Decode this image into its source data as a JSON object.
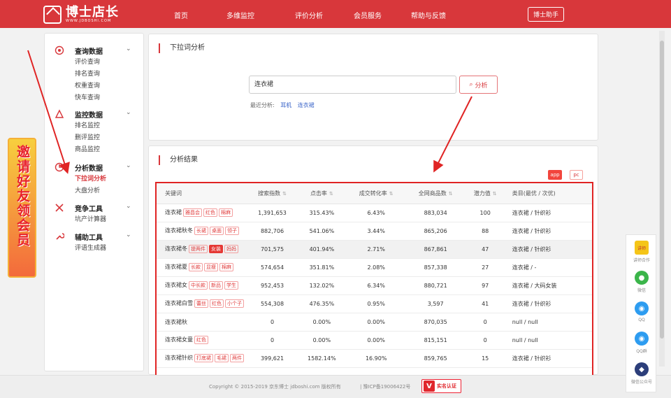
{
  "header": {
    "logo_title": "博士店长",
    "logo_sub": "WWW.JDBOSHI.COM",
    "nav": [
      "首页",
      "多维监控",
      "评价分析",
      "会员服务",
      "帮助与反馈"
    ],
    "helper_button": "博士助手"
  },
  "sidebar": {
    "groups": [
      {
        "title": "查询数据",
        "icon": "query-icon",
        "items": [
          "评价查询",
          "排名查询",
          "权重查询",
          "快车查询"
        ]
      },
      {
        "title": "监控数据",
        "icon": "monitor-icon",
        "items": [
          "排名监控",
          "删评监控",
          "商品监控"
        ]
      },
      {
        "title": "分析数据",
        "icon": "analysis-icon",
        "items": [
          "下拉词分析",
          "大盘分析"
        ]
      },
      {
        "title": "竞争工具",
        "icon": "compete-icon",
        "items": [
          "坑产计算器"
        ]
      },
      {
        "title": "辅助工具",
        "icon": "wrench-icon",
        "items": [
          "评语生成器"
        ]
      }
    ],
    "active_item": "下拉词分析"
  },
  "promo": {
    "text": "邀请好友领会员"
  },
  "search_panel": {
    "title": "下拉词分析",
    "input_value": "连衣裙",
    "button_label": "分析",
    "recent_label": "最近分析:",
    "recent_items": [
      "耳机",
      "连衣裙"
    ]
  },
  "results_panel": {
    "title": "分析结果",
    "toggle": [
      "app",
      "pc"
    ],
    "columns": [
      "关键词",
      "搜索指数",
      "点击率",
      "成交转化率",
      "全网商品数",
      "潜力值",
      "类目(最优 / 次优)"
    ],
    "rows": [
      {
        "keyword": "连衣裙",
        "tags": [
          "雅昌会",
          "红色",
          "棉麻"
        ],
        "search": "1,391,653",
        "ctr": "315.43%",
        "cvr": "6.43%",
        "goods": "883,034",
        "potential": "100",
        "category": "连衣裙 / 针织衫"
      },
      {
        "keyword": "连衣裙秋冬",
        "tags": [
          "长裙",
          "桌面",
          "领子"
        ],
        "search": "882,706",
        "ctr": "541.06%",
        "cvr": "3.44%",
        "goods": "865,206",
        "potential": "88",
        "category": "连衣裙 / 针织衫"
      },
      {
        "keyword": "连衣裙冬",
        "tags": [
          "提两件",
          "女装",
          "妈妈"
        ],
        "search": "701,575",
        "ctr": "401.94%",
        "cvr": "2.71%",
        "goods": "867,861",
        "potential": "47",
        "category": "连衣裙 / 针织衫"
      },
      {
        "keyword": "连衣裙夏",
        "tags": [
          "长款",
          "显瘦",
          "棉麻"
        ],
        "search": "574,654",
        "ctr": "351.81%",
        "cvr": "2.08%",
        "goods": "857,338",
        "potential": "27",
        "category": "连衣裙 / -"
      },
      {
        "keyword": "连衣裙女",
        "tags": [
          "中长款",
          "新品",
          "学生"
        ],
        "search": "952,453",
        "ctr": "132.02%",
        "cvr": "6.34%",
        "goods": "880,721",
        "potential": "97",
        "category": "连衣裙 / 大码女装"
      },
      {
        "keyword": "连衣裙白雪",
        "tags": [
          "蕾丝",
          "红色",
          "小个子"
        ],
        "search": "554,308",
        "ctr": "476.35%",
        "cvr": "0.95%",
        "goods": "3,597",
        "potential": "41",
        "category": "连衣裙 / 针织衫"
      },
      {
        "keyword": "连衣裙秋",
        "tags": [],
        "search": "0",
        "ctr": "0.00%",
        "cvr": "0.00%",
        "goods": "870,035",
        "potential": "0",
        "category": "null / null"
      },
      {
        "keyword": "连衣裙女童",
        "tags": [
          "红色"
        ],
        "search": "0",
        "ctr": "0.00%",
        "cvr": "0.00%",
        "goods": "815,151",
        "potential": "0",
        "category": "null / null"
      },
      {
        "keyword": "连衣裙针织",
        "tags": [
          "打底裙",
          "毛裙",
          "两件"
        ],
        "search": "399,621",
        "ctr": "1582.14%",
        "cvr": "16.90%",
        "goods": "859,765",
        "potential": "15",
        "category": "连衣裙 / 针织衫"
      }
    ]
  },
  "footer": {
    "copyright": "Copyright © 2015-2019 京东博士 jdboshi.com 版权所有",
    "icp": "|   豫ICP备19006422号",
    "badge": "实名认证"
  },
  "tools": [
    {
      "label": "讲师合作",
      "icon": "cooperation-icon",
      "color": "#f5c518"
    },
    {
      "label": "微信",
      "icon": "wechat-icon",
      "color": "#3bb54a"
    },
    {
      "label": "QQ",
      "icon": "qq-icon",
      "color": "#2d9cf0"
    },
    {
      "label": "QQ群",
      "icon": "qq-group-icon",
      "color": "#2d9cf0"
    },
    {
      "label": "微信公众号",
      "icon": "wechat-official-icon",
      "color": "#2c3e7a"
    }
  ]
}
